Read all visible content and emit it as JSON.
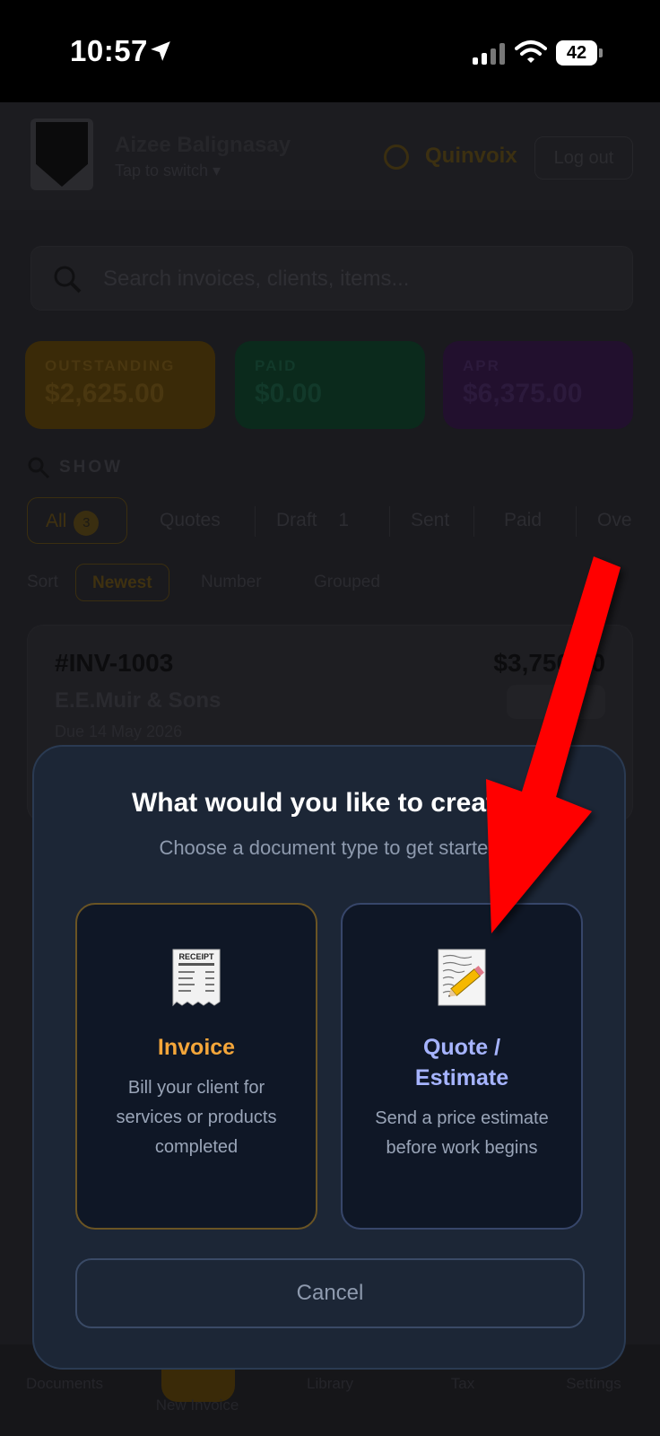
{
  "status_bar": {
    "time": "10:57",
    "battery": "42",
    "icons": [
      "location-arrow-icon",
      "signal-icon",
      "wifi-icon",
      "battery-icon"
    ]
  },
  "header": {
    "user_name": "Aizee Balignasay",
    "switch_hint": "Tap to switch ▾",
    "brand": "Quinvoix",
    "logout_label": "Log out"
  },
  "search": {
    "placeholder": "Search invoices, clients, items..."
  },
  "stats": [
    {
      "label": "OUTSTANDING",
      "value": "$2,625.00",
      "color": "#f5a623"
    },
    {
      "label": "PAID",
      "value": "$0.00",
      "color": "#1fae6a"
    },
    {
      "label": "APR",
      "value": "$6,375.00",
      "color": "#8a3fd1"
    }
  ],
  "filters": {
    "show_label": "SHOW",
    "chips": [
      {
        "label": "All",
        "count": "3"
      },
      {
        "label": "Quotes"
      },
      {
        "label": "Draft",
        "count": "1"
      },
      {
        "label": "Sent"
      },
      {
        "label": "Paid"
      },
      {
        "label": "Ove"
      }
    ]
  },
  "sort": {
    "label": "Sort",
    "options": [
      "Newest",
      "Number",
      "Grouped"
    ]
  },
  "invoice": {
    "number": "#INV-1003",
    "amount": "$3,750.00",
    "client": "E.E.Muir & Sons",
    "due": "Due 14 May 2026"
  },
  "tab_bar": {
    "items": [
      "Documents",
      "New Invoice",
      "Library",
      "Tax",
      "Settings"
    ]
  },
  "modal": {
    "title": "What would you like to create?",
    "subtitle": "Choose a document type to get started",
    "options": [
      {
        "icon": "receipt-icon",
        "title": "Invoice",
        "description": "Bill your client for services or products completed"
      },
      {
        "icon": "memo-pencil-icon",
        "title_line1": "Quote /",
        "title_line2": "Estimate",
        "description": "Send a price estimate before work begins"
      }
    ],
    "cancel_label": "Cancel"
  },
  "colors": {
    "accent": "#f4a63a",
    "quote_accent": "#a6b4ff",
    "modal_bg": "#1c2636",
    "annotation": "#ff0000"
  }
}
